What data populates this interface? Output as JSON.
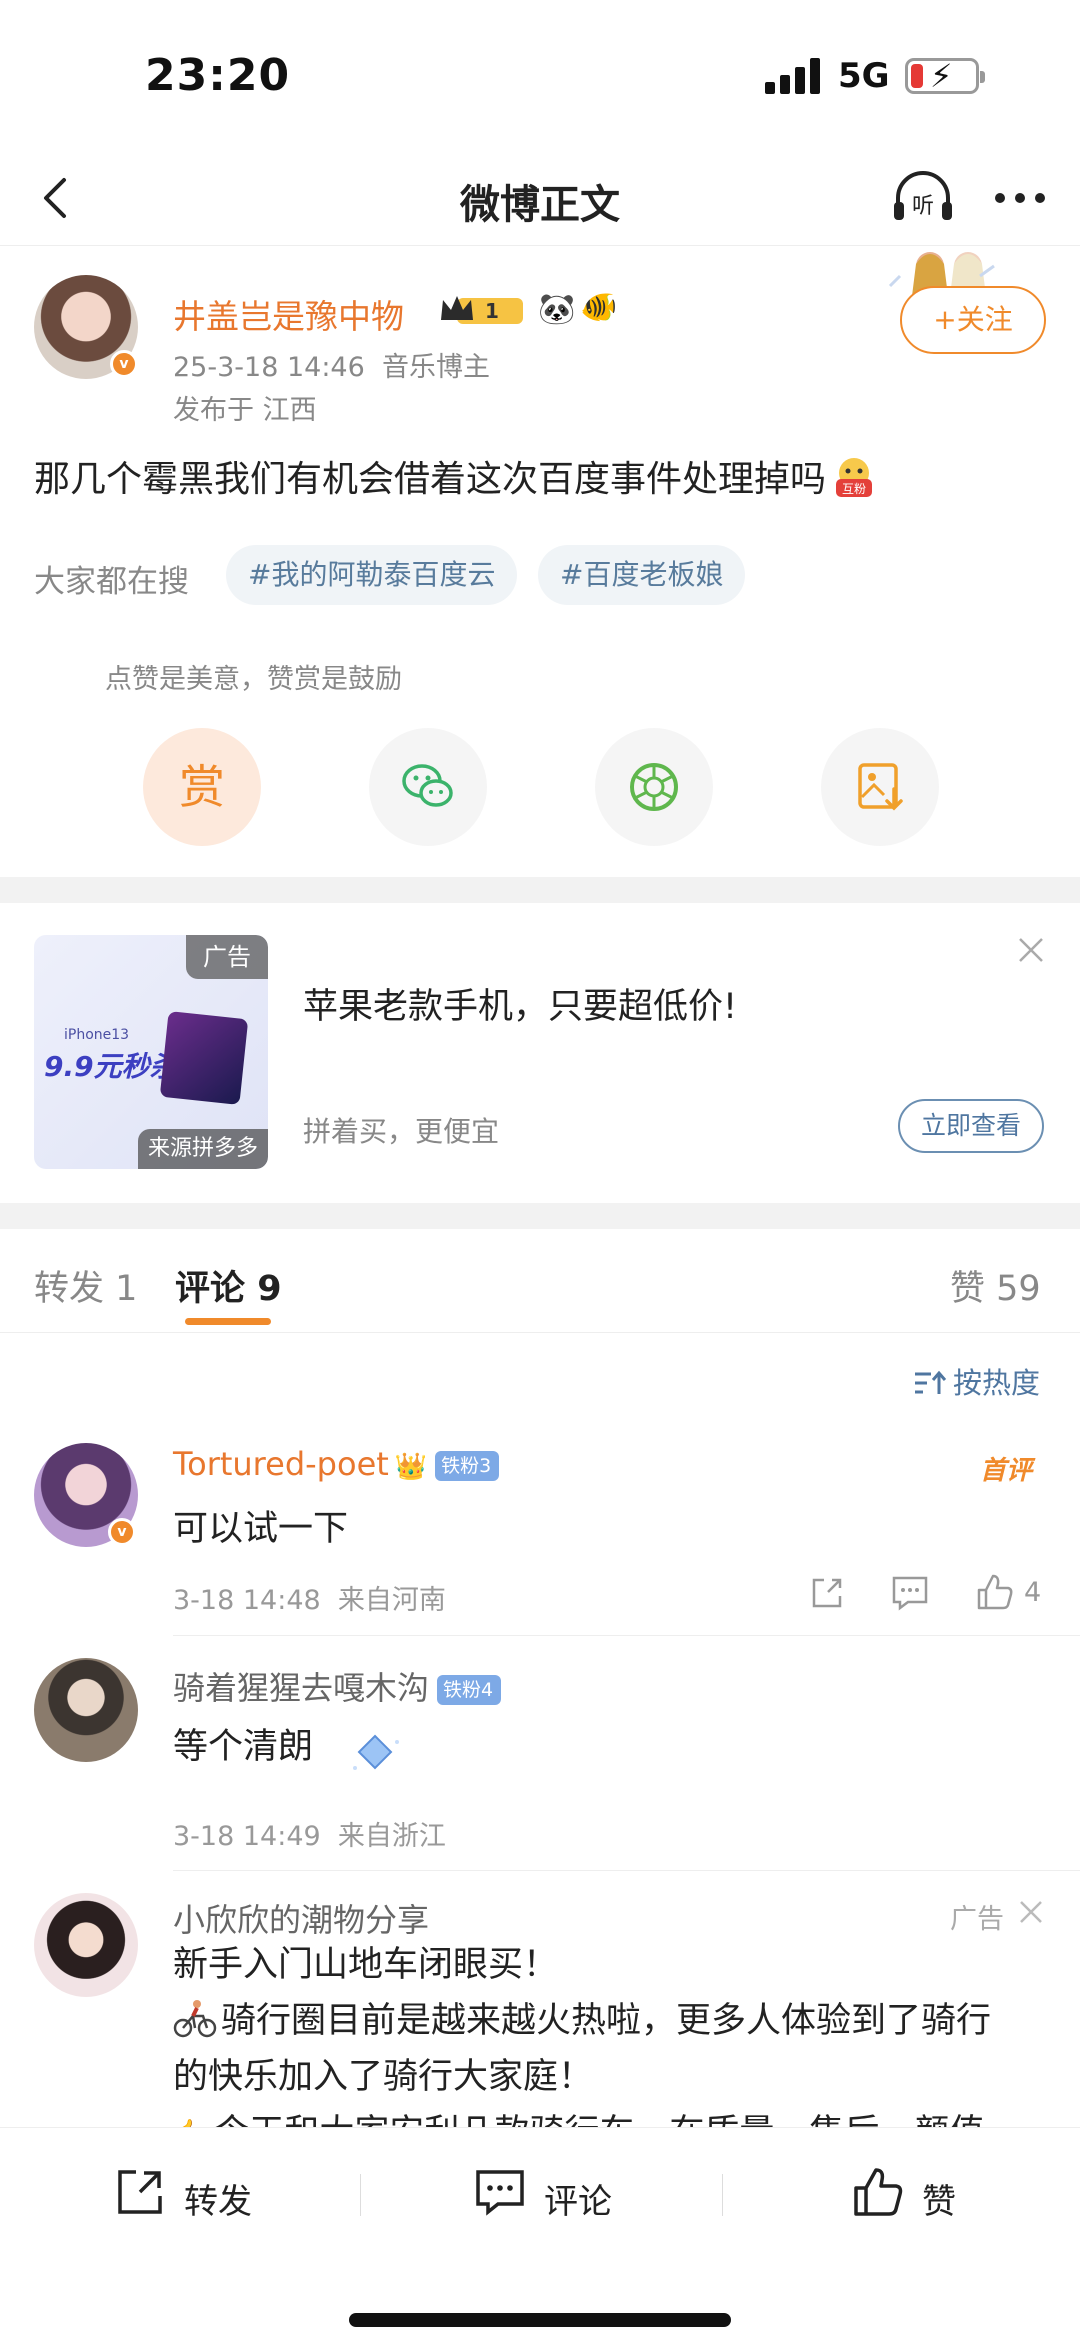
{
  "status": {
    "time": "23:20",
    "network": "5G",
    "battery_level": 0.2
  },
  "nav": {
    "title": "微博正文",
    "listen_label": "听"
  },
  "post": {
    "author": "井盖岂是豫中物",
    "vip_level": "1",
    "time": "25-3-18 14:46",
    "role": "音乐博主",
    "location": "发布于 江西",
    "follow_label": "+关注",
    "text": "那几个霉黑我们有机会借着这次百度事件处理掉吗",
    "emoji_label": "互粉",
    "search_label": "大家都在搜",
    "tags": [
      "#我的阿勒泰百度云",
      "#百度老板娘"
    ],
    "reward_tip": "点赞是美意，赞赏是鼓励",
    "reward_label": "赏"
  },
  "ad": {
    "tag": "广告",
    "model": "iPhone13",
    "price": "9.9元秒杀",
    "source": "来源拼多多",
    "title": "苹果老款手机，只要超低价!",
    "subtitle": "拼着买，更便宜",
    "button": "立即查看"
  },
  "tabs": {
    "repost_label": "转发",
    "repost_count": "1",
    "comment_label": "评论",
    "comment_count": "9",
    "like_label": "赞",
    "like_count": "59"
  },
  "sort_label": "按热度",
  "comments": [
    {
      "name": "Tortured-poet",
      "badge": "铁粉3",
      "first_label": "首评",
      "text": "可以试一下",
      "time": "3-18 14:48",
      "source": "来自河南",
      "likes": "4"
    },
    {
      "name": "骑着猩猩去嘎木沟",
      "badge": "铁粉4",
      "text": "等个清朗",
      "time": "3-18 14:49",
      "source": "来自浙江"
    }
  ],
  "ad_comment": {
    "name": "小欣欣的潮物分享",
    "ad_label": "广告",
    "line1": "新手入门山地车闭眼买！",
    "line2": "骑行圈目前是越来越火热啦，更多人体验到了骑行",
    "line3": "的快乐加入了骑行大家庭！",
    "line4": "今天和大家安利几款骑行车，在质量、售后、颜值"
  },
  "bottom_bar": {
    "repost": "转发",
    "comment": "评论",
    "like": "赞"
  },
  "colors": {
    "accent": "#f08a2b",
    "link": "#4f76a0",
    "tag_bg": "#f0f4f7"
  }
}
